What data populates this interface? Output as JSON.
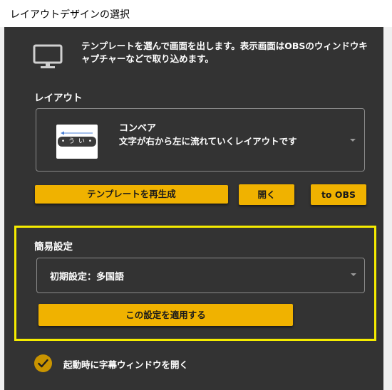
{
  "window": {
    "title": "レイアウトデザインの選択"
  },
  "intro": {
    "icon": "monitor-icon",
    "text": "テンプレートを選んで画面を出します。表示画面はOBSのウィンドウキャプチャーなどで取り込めます。"
  },
  "layout": {
    "section_label": "レイアウト",
    "selected": {
      "name": "コンベア",
      "description": "文字が右から左に流れていくレイアウトです",
      "thumbnail_text": "• う い •"
    }
  },
  "actions": {
    "regenerate_label": "テンプレートを再生成",
    "open_label": "開く",
    "to_obs_label": "to OBS"
  },
  "quick_settings": {
    "section_label": "簡易設定",
    "preset_value": "初期設定：多国語",
    "apply_label": "この設定を適用する"
  },
  "startup": {
    "checked": true,
    "label": "起動時に字幕ウィンドウを開く"
  },
  "colors": {
    "panel_bg": "#333333",
    "accent": "#f0b200",
    "highlight_border": "#f5ec00",
    "checkbox": "#c99400"
  }
}
